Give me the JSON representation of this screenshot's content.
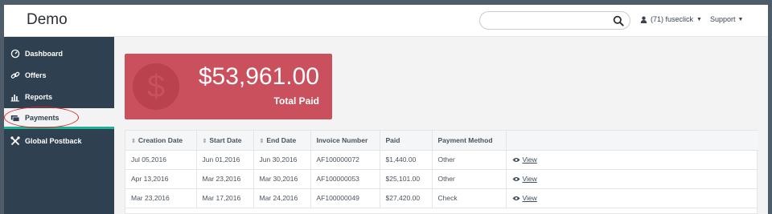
{
  "header": {
    "brand": "Demo",
    "search": {
      "placeholder": "",
      "value": ""
    },
    "user_label": "(71) fuseclick",
    "support_label": "Support"
  },
  "sidebar": {
    "items": [
      {
        "label": "Dashboard",
        "icon": "dashboard-icon"
      },
      {
        "label": "Offers",
        "icon": "link-icon"
      },
      {
        "label": "Reports",
        "icon": "bar-chart-icon"
      },
      {
        "label": "Payments",
        "icon": "money-icon",
        "active": true
      },
      {
        "label": "Global Postback",
        "icon": "tools-icon"
      }
    ]
  },
  "summary": {
    "amount": "$53,961.00",
    "label": "Total Paid",
    "symbol": "$",
    "color": "#c9505c"
  },
  "table": {
    "columns": [
      "Creation Date",
      "Start Date",
      "End Date",
      "Invoice Number",
      "Paid",
      "Payment Method",
      ""
    ],
    "rows": [
      {
        "creation": "Jul 05,2016",
        "start": "Jun 01,2016",
        "end": "Jun 30,2016",
        "invoice": "AF100000072",
        "paid": "$1,440.00",
        "method": "Other",
        "action": "View"
      },
      {
        "creation": "Apr 13,2016",
        "start": "Mar 23,2016",
        "end": "Mar 30,2016",
        "invoice": "AF100000053",
        "paid": "$25,101.00",
        "method": "Other",
        "action": "View"
      },
      {
        "creation": "Mar 23,2016",
        "start": "Mar 17,2016",
        "end": "Mar 24,2016",
        "invoice": "AF100000049",
        "paid": "$27,420.00",
        "method": "Check",
        "action": "View"
      }
    ]
  },
  "colors": {
    "sidebar": "#2f4050",
    "accent": "#1ab394",
    "annotation": "#d9282b"
  }
}
